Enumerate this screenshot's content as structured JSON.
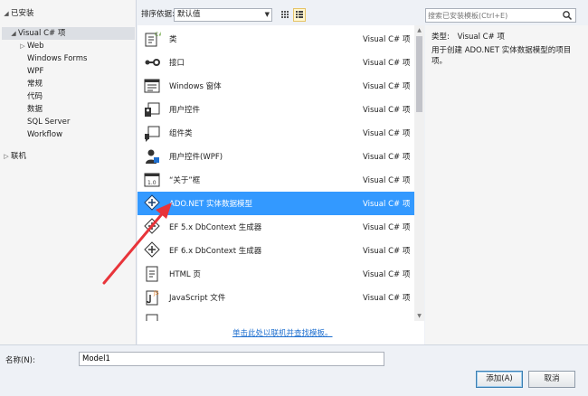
{
  "tree": {
    "installed": "已安装",
    "visual_cs": "Visual C# 项",
    "children": [
      "Web",
      "Windows Forms",
      "WPF",
      "常规",
      "代码",
      "数据",
      "SQL Server",
      "Workflow"
    ],
    "online": "联机"
  },
  "toolbar": {
    "sort_label": "排序依据:",
    "sort_value": "默认值"
  },
  "search": {
    "placeholder": "搜索已安装模板(Ctrl+E)"
  },
  "items": [
    {
      "name": "类",
      "type": "Visual C# 项",
      "icon": "class-icon"
    },
    {
      "name": "接口",
      "type": "Visual C# 项",
      "icon": "interface-icon"
    },
    {
      "name": "Windows 窗体",
      "type": "Visual C# 项",
      "icon": "form-icon"
    },
    {
      "name": "用户控件",
      "type": "Visual C# 项",
      "icon": "user-control-icon"
    },
    {
      "name": "组件类",
      "type": "Visual C# 项",
      "icon": "component-icon"
    },
    {
      "name": "用户控件(WPF)",
      "type": "Visual C# 项",
      "icon": "wpf-user-control-icon"
    },
    {
      "name": "“关于”框",
      "type": "Visual C# 项",
      "icon": "about-box-icon"
    },
    {
      "name": "ADO.NET 实体数据模型",
      "type": "Visual C# 项",
      "icon": "entity-model-icon",
      "selected": true
    },
    {
      "name": "EF 5.x DbContext 生成器",
      "type": "Visual C# 项",
      "icon": "ef5-generator-icon"
    },
    {
      "name": "EF 6.x DbContext 生成器",
      "type": "Visual C# 项",
      "icon": "ef6-generator-icon"
    },
    {
      "name": "HTML 页",
      "type": "Visual C# 项",
      "icon": "html-page-icon"
    },
    {
      "name": "JavaScript 文件",
      "type": "Visual C# 项",
      "icon": "javascript-file-icon"
    }
  ],
  "online_link": "单击此处以联机并查找模板。",
  "details": {
    "type_label": "类型:",
    "type_value": "Visual C# 项",
    "description": "用于创建 ADO.NET 实体数据模型的项目项。"
  },
  "name_field": {
    "label": "名称(N):",
    "value": "Model1"
  },
  "buttons": {
    "add": "添加(A)",
    "cancel": "取消"
  },
  "colors": {
    "selection": "#3399ff",
    "annotation_arrow": "#e8343a"
  }
}
